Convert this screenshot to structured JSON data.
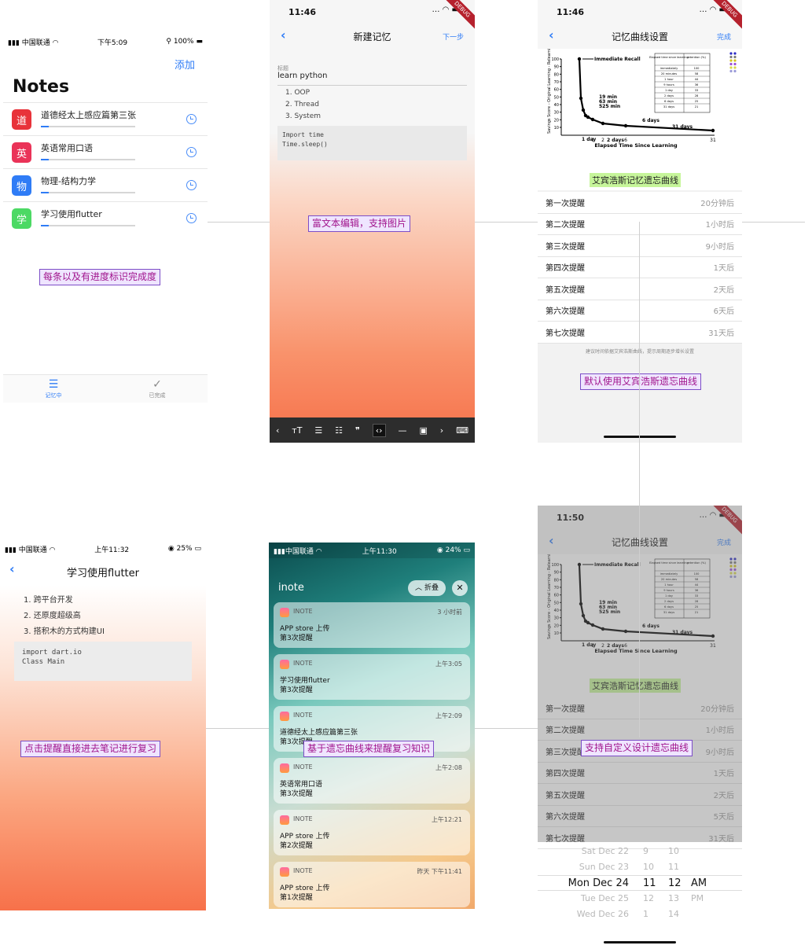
{
  "annotations": {
    "progress": "每条以及有进度标识完成度",
    "rich_text": "富文本编辑，支持图片",
    "ebbinghaus_default": "默认使用艾宾浩斯遗忘曲线",
    "custom_curve": "支持自定义设计遗忘曲线",
    "curve_reminder": "基于遗忘曲线来提醒复习知识",
    "tap_to_review": "点击提醒直接进去笔记进行复习"
  },
  "notes_screen": {
    "carrier": "中国联通",
    "time": "下午5:09",
    "battery": "100%",
    "add_label": "添加",
    "title": "Notes",
    "items": [
      {
        "badge": "道",
        "color": "#e8333a",
        "title": "道德经太上感应篇第三张",
        "progress": 0.08
      },
      {
        "badge": "英",
        "color": "#ea3358",
        "title": "英语常用口语",
        "progress": 0.08
      },
      {
        "badge": "物",
        "color": "#2f7cf6",
        "title": "物理-结构力学",
        "progress": 0.08
      },
      {
        "badge": "学",
        "color": "#4cd964",
        "title": "学习使用flutter",
        "progress": 0.08
      }
    ],
    "tabs": [
      {
        "label": "记忆中"
      },
      {
        "label": "已完成"
      }
    ]
  },
  "editor_screen": {
    "time": "11:46",
    "debug": "DEBUG",
    "title": "新建记忆",
    "next": "下一步",
    "field_label": "标题",
    "field_value": "learn python",
    "list": [
      "OOP",
      "Thread",
      "System"
    ],
    "code": [
      "Import time",
      "Time.sleep()"
    ]
  },
  "curve_screen": {
    "time": "11:46",
    "debug": "DEBUG",
    "title": "记忆曲线设置",
    "done": "完成",
    "caption": "艾宾浩斯记忆遗忘曲线",
    "chart": {
      "legend": "Immediate Recall",
      "xlabel": "Elapsed Time Since Learning",
      "ylabel": "Savings Score - Original Learning - Relearning / Original Learning ×100",
      "yticks": [
        "100",
        "90",
        "80",
        "70",
        "60",
        "50",
        "40",
        "30",
        "20",
        "10"
      ],
      "xticks": [
        "1",
        "2",
        "6",
        "31"
      ],
      "point_labels": [
        "19 min",
        "63 min",
        "525 min",
        "6 days",
        "31 days",
        "1 day",
        "2 days"
      ],
      "table_headers": [
        "Elapsed time since learning",
        "retention (%)"
      ],
      "table_rows": [
        [
          "immediately",
          "100"
        ],
        [
          "20 minutes",
          "58"
        ],
        [
          "1 hour",
          "44"
        ],
        [
          "9 hours",
          "36"
        ],
        [
          "1 day",
          "33"
        ],
        [
          "2 days",
          "28"
        ],
        [
          "6 days",
          "25"
        ],
        [
          "31 days",
          "21"
        ]
      ]
    },
    "reminders": [
      {
        "label": "第一次提醒",
        "value": "20分钟后"
      },
      {
        "label": "第二次提醒",
        "value": "1小时后"
      },
      {
        "label": "第三次提醒",
        "value": "9小时后"
      },
      {
        "label": "第四次提醒",
        "value": "1天后"
      },
      {
        "label": "第五次提醒",
        "value": "2天后"
      },
      {
        "label": "第六次提醒",
        "value": "6天后"
      },
      {
        "label": "第七次提醒",
        "value": "31天后"
      }
    ],
    "note": "建议时间依据艾宾浩斯曲线，提示周期逐步增长设置"
  },
  "curve_screen_2": {
    "time": "11:50",
    "debug": "DEBUG",
    "title": "记忆曲线设置",
    "done": "完成",
    "caption": "艾宾浩斯记忆遗忘曲线",
    "reminders": [
      {
        "label": "第一次提醒",
        "value": "20分钟后"
      },
      {
        "label": "第二次提醒",
        "value": "1小时后"
      },
      {
        "label": "第三次提醒",
        "value": "9小时后"
      },
      {
        "label": "第四次提醒",
        "value": "1天后"
      },
      {
        "label": "第五次提醒",
        "value": "2天后"
      },
      {
        "label": "第六次提醒",
        "value": "5天后"
      },
      {
        "label": "第七次提醒",
        "value": "31天后"
      }
    ],
    "picker": {
      "rows": [
        {
          "date": "Sat Dec 22",
          "h": "9",
          "m": "10",
          "ap": ""
        },
        {
          "date": "Sun Dec 23",
          "h": "10",
          "m": "11",
          "ap": ""
        },
        {
          "date": "Mon Dec 24",
          "h": "11",
          "m": "12",
          "ap": "AM"
        },
        {
          "date": "Tue Dec 25",
          "h": "12",
          "m": "13",
          "ap": "PM"
        },
        {
          "date": "Wed Dec 26",
          "h": "1",
          "m": "14",
          "ap": ""
        }
      ]
    }
  },
  "detail_screen": {
    "carrier": "中国联通",
    "time": "上午11:32",
    "battery": "25%",
    "title": "学习使用flutter",
    "list": [
      "跨平台开发",
      "还原度超级高",
      "搭积木的方式构建UI"
    ],
    "code": [
      "import dart.io",
      "Class Main"
    ]
  },
  "notification_screen": {
    "carrier": "中国联通",
    "time": "上午11:30",
    "battery": "24%",
    "app_title": "inote",
    "collapse": "折叠",
    "close": "✕",
    "items": [
      {
        "app": "INOTE",
        "time": "3 小时前",
        "title": "APP store 上传",
        "body": "第3次提醒"
      },
      {
        "app": "INOTE",
        "time": "上午3:05",
        "title": "学习使用flutter",
        "body": "第3次提醒"
      },
      {
        "app": "INOTE",
        "time": "上午2:09",
        "title": "道德经太上感应篇第三张",
        "body": "第3次提醒"
      },
      {
        "app": "INOTE",
        "time": "上午2:08",
        "title": "英语常用口语",
        "body": "第3次提醒"
      },
      {
        "app": "INOTE",
        "time": "上午12:21",
        "title": "APP store 上传",
        "body": "第2次提醒"
      },
      {
        "app": "INOTE",
        "time": "昨天 下午11:41",
        "title": "APP store 上传",
        "body": "第1次提醒"
      }
    ]
  }
}
